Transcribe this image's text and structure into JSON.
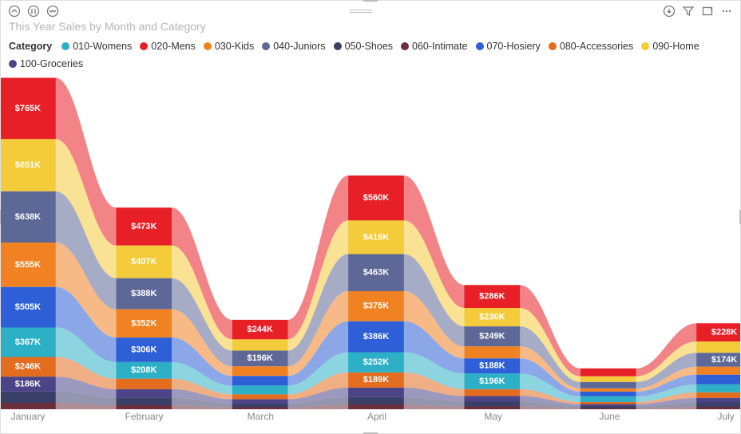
{
  "title": "This Year Sales by Month and Category",
  "legend_title": "Category",
  "toolbar_icons": {
    "drill_up": "drill-up",
    "drill_down": "drill-down",
    "expand": "expand-hierarchy",
    "export": "export",
    "filter": "filter",
    "focus": "focus-mode",
    "more": "more-options",
    "grip": "drag-grip"
  },
  "chart_data": {
    "type": "area",
    "categories": [
      "January",
      "February",
      "March",
      "April",
      "May",
      "June",
      "July"
    ],
    "series": [
      {
        "name": "010-Womens",
        "color": "#2db0c6",
        "values": [
          367,
          208,
          110,
          252,
          196,
          70,
          100
        ]
      },
      {
        "name": "020-Mens",
        "color": "#e71f27",
        "values": [
          765,
          473,
          244,
          560,
          286,
          100,
          228
        ]
      },
      {
        "name": "030-Kids",
        "color": "#f08224",
        "values": [
          555,
          352,
          120,
          375,
          150,
          40,
          100
        ]
      },
      {
        "name": "040-Juniors",
        "color": "#5d6896",
        "values": [
          638,
          388,
          196,
          463,
          249,
          80,
          174
        ]
      },
      {
        "name": "050-Shoes",
        "color": "#3a3f68",
        "values": [
          140,
          90,
          45,
          90,
          60,
          25,
          55
        ]
      },
      {
        "name": "060-Intimate",
        "color": "#6b2e3a",
        "values": [
          80,
          50,
          25,
          60,
          35,
          15,
          30
        ]
      },
      {
        "name": "070-Hosiery",
        "color": "#2e5fd6",
        "values": [
          505,
          306,
          120,
          386,
          188,
          60,
          120
        ]
      },
      {
        "name": "080-Accessories",
        "color": "#e36c1f",
        "values": [
          246,
          130,
          60,
          189,
          85,
          25,
          70
        ]
      },
      {
        "name": "090-Home",
        "color": "#f4cb3a",
        "values": [
          651,
          407,
          140,
          419,
          230,
          70,
          140
        ]
      },
      {
        "name": "100-Groceries",
        "color": "#4c4487",
        "values": [
          186,
          110,
          55,
          120,
          70,
          25,
          55
        ]
      }
    ],
    "visible_labels": {
      "January": [
        "$765K",
        "$651K",
        "$638K",
        "$555K",
        "$505K",
        "$367K",
        "$246K",
        "$186K"
      ],
      "February": [
        "$473K",
        "$407K",
        "$388K",
        "$352K",
        "$306K",
        "$208K"
      ],
      "March": [
        "$244K",
        "$196K"
      ],
      "April": [
        "$560K",
        "$463K",
        "$419K",
        "$386K",
        "$375K",
        "$252K",
        "$189K"
      ],
      "May": [
        "$286K",
        "$249K",
        "$230K",
        "$196K",
        "$188K"
      ],
      "June": [],
      "July": [
        "$228K",
        "$174K"
      ]
    },
    "label_series_lookup": {
      "$765K": "020-Mens",
      "$651K": "090-Home",
      "$638K": "040-Juniors",
      "$555K": "030-Kids",
      "$505K": "070-Hosiery",
      "$367K": "010-Womens",
      "$246K": "080-Accessories",
      "$186K": "100-Groceries",
      "$473K": "020-Mens",
      "$407K": "090-Home",
      "$388K": "040-Juniors",
      "$352K": "030-Kids",
      "$306K": "070-Hosiery",
      "$208K": "010-Womens",
      "$244K": "020-Mens",
      "$196K": "040-Juniors",
      "$560K": "020-Mens",
      "$463K": "040-Juniors",
      "$419K": "090-Home",
      "$386K": "070-Hosiery",
      "$375K": "030-Kids",
      "$252K": "010-Womens",
      "$189K": "080-Accessories",
      "$286K": "020-Mens",
      "$249K": "040-Juniors",
      "$230K": "090-Home",
      "$188K": "070-Hosiery",
      "$228K": "020-Mens",
      "$174K": "040-Juniors"
    },
    "stack_order_top_to_bottom": [
      "020-Mens",
      "090-Home",
      "040-Juniors",
      "030-Kids",
      "070-Hosiery",
      "010-Womens",
      "080-Accessories",
      "100-Groceries",
      "050-Shoes",
      "060-Intimate"
    ],
    "xlabel": "",
    "ylabel": "",
    "stacked": true
  }
}
